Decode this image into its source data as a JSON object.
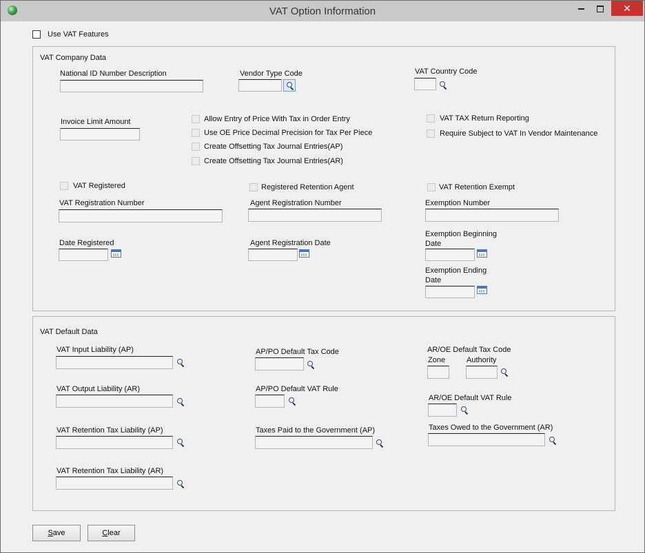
{
  "window": {
    "title": "VAT Option Information",
    "close_glyph": "✕"
  },
  "options": {
    "use_vat_features": "Use VAT Features"
  },
  "company": {
    "group_label": "VAT Company Data",
    "national_id_desc": "National ID Number Description",
    "vendor_type_code": "Vendor Type Code",
    "vat_country_code": "VAT Country Code",
    "invoice_limit_amount": "Invoice Limit Amount",
    "allow_price_with_tax": "Allow Entry of Price With Tax in Order Entry",
    "use_oe_price_decimal": "Use OE Price Decimal Precision for Tax Per Piece",
    "create_offset_ap": "Create Offsetting Tax Journal Entries(AP)",
    "create_offset_ar": "Create Offsetting Tax Journal Entries(AR)",
    "vat_tax_return_reporting": "VAT TAX Return Reporting",
    "require_subject_to_vat": "Require Subject to VAT In Vendor Maintenance",
    "vat_registered": "VAT Registered",
    "registered_retention_agent": "Registered Retention Agent",
    "vat_retention_exempt": "VAT Retention Exempt",
    "vat_registration_number": "VAT Registration Number",
    "agent_registration_number": "Agent Registration Number",
    "exemption_number": "Exemption Number",
    "date_registered": "Date Registered",
    "agent_registration_date": "Agent Registration Date",
    "exemption_beginning_1": "Exemption Beginning",
    "exemption_beginning_2": "Date",
    "exemption_ending_1": "Exemption Ending",
    "exemption_ending_2": "Date"
  },
  "defaults": {
    "group_label": "VAT Default Data",
    "vat_input_liability": "VAT Input Liability (AP)",
    "vat_output_liability": "VAT Output Liability (AR)",
    "vat_retention_ap": "VAT Retention Tax Liability (AP)",
    "vat_retention_ar": "VAT Retention Tax Liability (AR)",
    "appo_tax_code": "AP/PO Default Tax Code",
    "appo_vat_rule": "AP/PO Default VAT Rule",
    "taxes_paid": "Taxes Paid to the Government (AP)",
    "aroe_tax_code": "AR/OE Default Tax Code",
    "zone": "Zone",
    "authority": "Authority",
    "aroe_vat_rule": "AR/OE Default VAT Rule",
    "taxes_owed": "Taxes Owed to the Government (AR)"
  },
  "buttons": {
    "save_mnemonic": "S",
    "save_rest": "ave",
    "clear_mnemonic": "C",
    "clear_rest": "lear"
  }
}
